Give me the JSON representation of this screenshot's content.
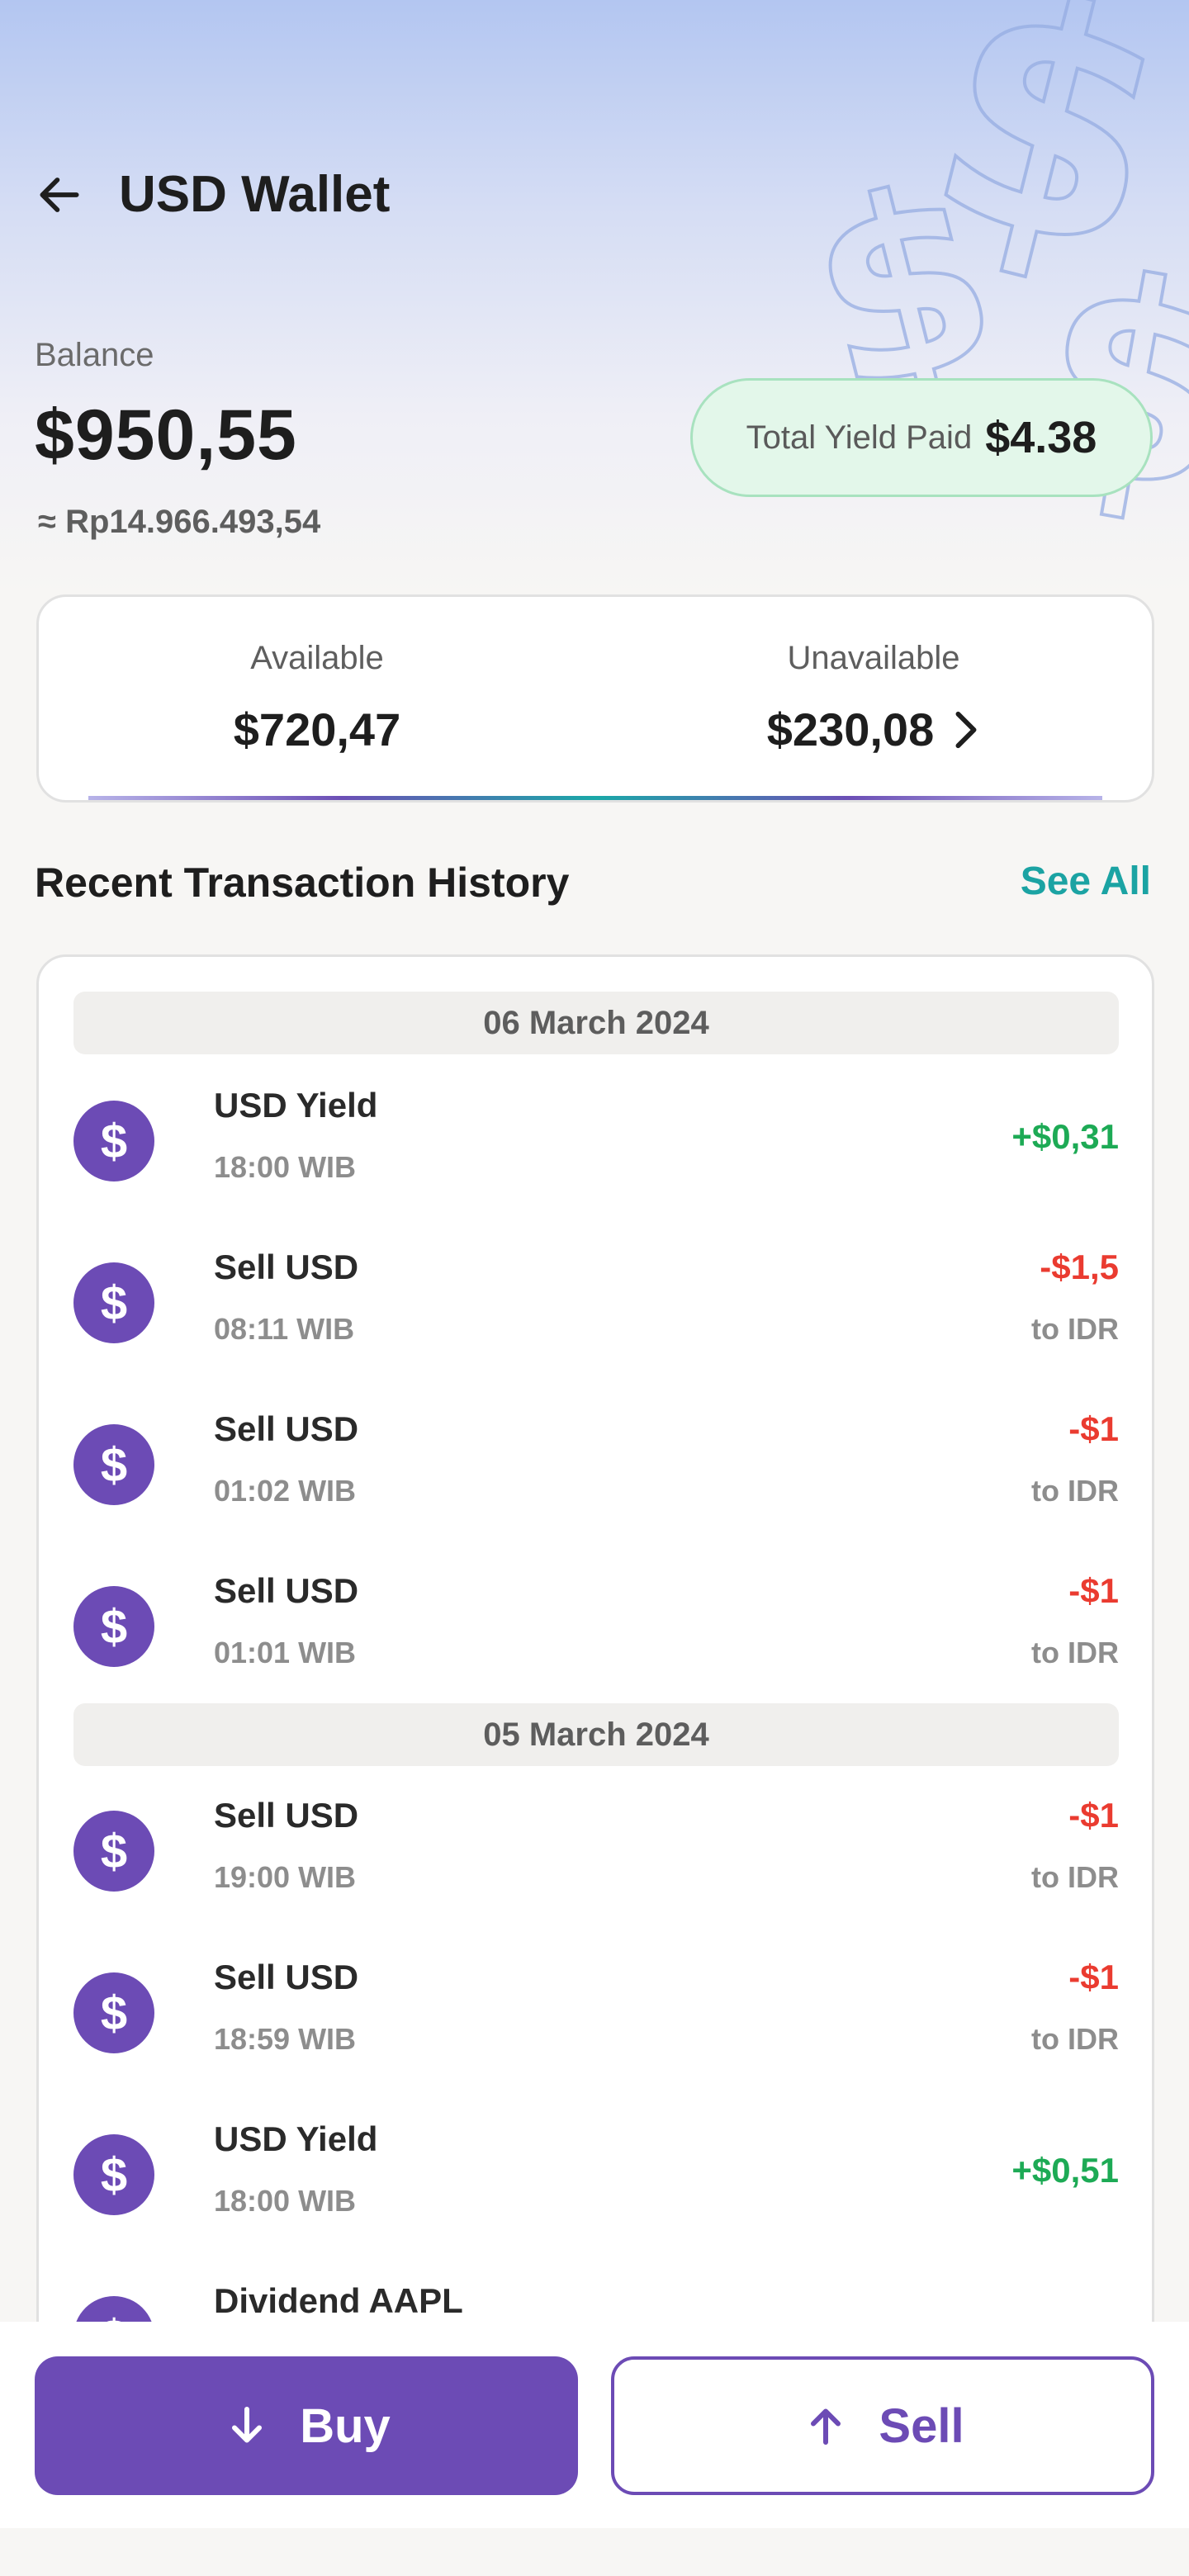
{
  "header": {
    "title": "USD Wallet",
    "back_icon": "arrow-left-icon"
  },
  "balance": {
    "label": "Balance",
    "value": "$950,55",
    "idr_equivalent": "≈ Rp14.966.493,54",
    "yield_label": "Total Yield Paid",
    "yield_value": "$4.38"
  },
  "availability": {
    "available_label": "Available",
    "available_value": "$720,47",
    "unavailable_label": "Unavailable",
    "unavailable_value": "$230,08"
  },
  "history": {
    "title": "Recent Transaction History",
    "see_all": "See All",
    "groups": [
      {
        "date": "06 March 2024",
        "items": [
          {
            "title": "USD Yield",
            "time": "18:00 WIB",
            "amount": "+$0,31",
            "sub": ""
          },
          {
            "title": "Sell USD",
            "time": "08:11 WIB",
            "amount": "-$1,5",
            "sub": "to IDR"
          },
          {
            "title": "Sell USD",
            "time": "01:02 WIB",
            "amount": "-$1",
            "sub": "to IDR"
          },
          {
            "title": "Sell USD",
            "time": "01:01 WIB",
            "amount": "-$1",
            "sub": "to IDR"
          }
        ]
      },
      {
        "date": "05 March 2024",
        "items": [
          {
            "title": "Sell USD",
            "time": "19:00 WIB",
            "amount": "-$1",
            "sub": "to IDR"
          },
          {
            "title": "Sell USD",
            "time": "18:59 WIB",
            "amount": "-$1",
            "sub": "to IDR"
          },
          {
            "title": "USD Yield",
            "time": "18:00 WIB",
            "amount": "+$0,51",
            "sub": ""
          },
          {
            "title": "Dividend AAPL",
            "time": "",
            "amount": "",
            "sub": ""
          }
        ]
      }
    ],
    "icon": "dollar-icon",
    "icon_glyph": "$"
  },
  "actions": {
    "buy_label": "Buy",
    "sell_label": "Sell"
  },
  "colors": {
    "primary": "#6c4bb5",
    "teal": "#1ba3a3",
    "positive": "#1daa55",
    "negative": "#ea3b30"
  }
}
